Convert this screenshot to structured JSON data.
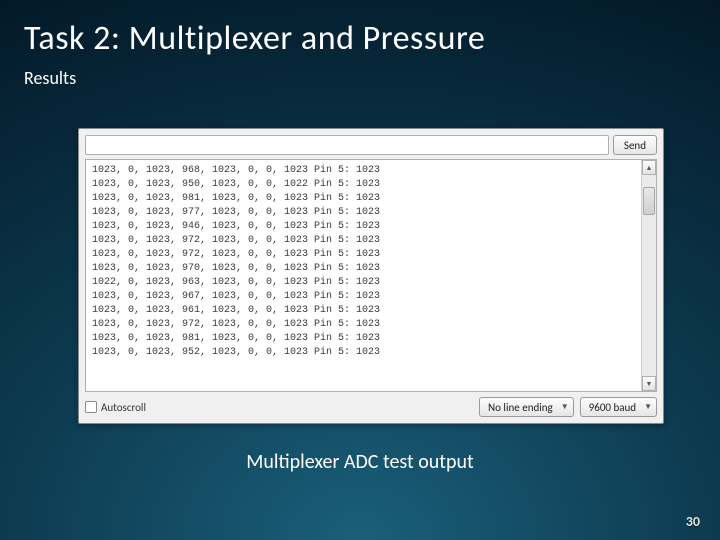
{
  "slide": {
    "title": "Task 2: Multiplexer and Pressure",
    "subtitle": "Results",
    "caption": "Multiplexer ADC test output",
    "page_number": "30"
  },
  "serial": {
    "input_value": "",
    "send_label": "Send",
    "autoscroll_label": "Autoscroll",
    "autoscroll_checked": false,
    "line_ending_selected": "No line ending",
    "baud_selected": "9600 baud",
    "lines": [
      "1023, 0, 1023, 968, 1023, 0, 0, 1023 Pin 5: 1023",
      "1023, 0, 1023, 950, 1023, 0, 0, 1022 Pin 5: 1023",
      "1023, 0, 1023, 981, 1023, 0, 0, 1023 Pin 5: 1023",
      "1023, 0, 1023, 977, 1023, 0, 0, 1023 Pin 5: 1023",
      "1023, 0, 1023, 946, 1023, 0, 0, 1023 Pin 5: 1023",
      "1023, 0, 1023, 972, 1023, 0, 0, 1023 Pin 5: 1023",
      "1023, 0, 1023, 972, 1023, 0, 0, 1023 Pin 5: 1023",
      "1023, 0, 1023, 970, 1023, 0, 0, 1023 Pin 5: 1023",
      "1022, 0, 1023, 963, 1023, 0, 0, 1023 Pin 5: 1023",
      "1023, 0, 1023, 967, 1023, 0, 0, 1023 Pin 5: 1023",
      "1023, 0, 1023, 961, 1023, 0, 0, 1023 Pin 5: 1023",
      "1023, 0, 1023, 972, 1023, 0, 0, 1023 Pin 5: 1023",
      "1023, 0, 1023, 981, 1023, 0, 0, 1023 Pin 5: 1023",
      "1023, 0, 1023, 952, 1023, 0, 0, 1023 Pin 5: 1023"
    ]
  }
}
